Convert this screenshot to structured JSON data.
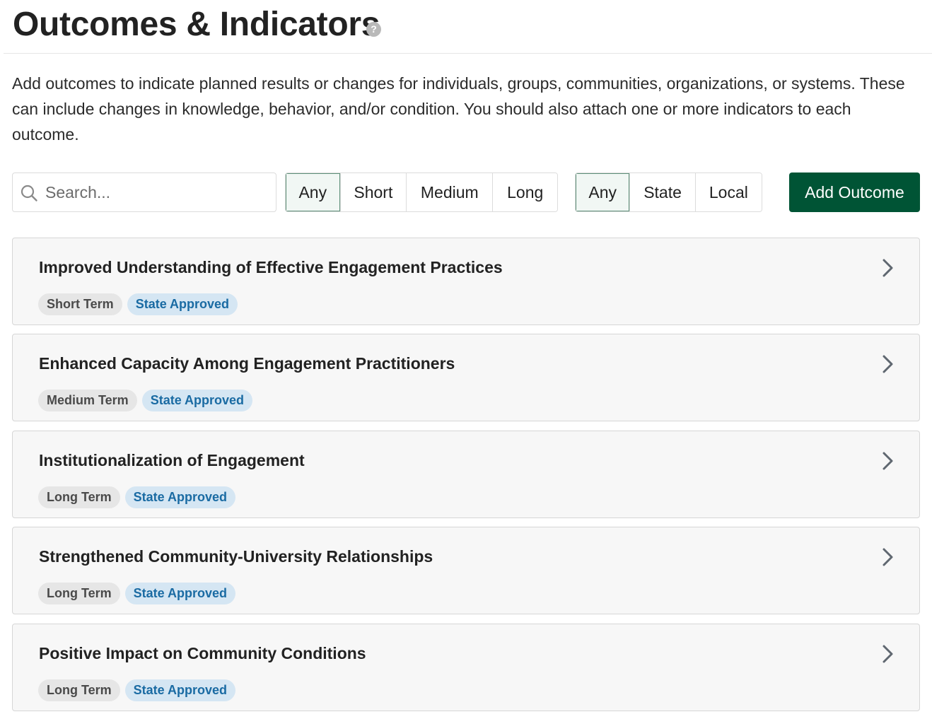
{
  "header": {
    "title": "Outcomes & Indicators",
    "help_glyph": "?"
  },
  "description": "Add outcomes to indicate planned results or changes for individuals, groups, communities, organizations, or systems. These can include changes in knowledge, behavior, and/or condition. You should also attach one or more indicators to each outcome.",
  "search": {
    "placeholder": "Search...",
    "value": ""
  },
  "term_filter": {
    "options": [
      "Any",
      "Short",
      "Medium",
      "Long"
    ],
    "selected": "Any"
  },
  "source_filter": {
    "options": [
      "Any",
      "State",
      "Local"
    ],
    "selected": "Any"
  },
  "add_button_label": "Add Outcome",
  "outcomes": [
    {
      "title": "Improved Understanding of Effective Engagement Practices",
      "term": "Short Term",
      "status": "State Approved"
    },
    {
      "title": "Enhanced Capacity Among Engagement Practitioners",
      "term": "Medium Term",
      "status": "State Approved"
    },
    {
      "title": "Institutionalization of Engagement",
      "term": "Long Term",
      "status": "State Approved"
    },
    {
      "title": "Strengthened Community-University Relationships",
      "term": "Long Term",
      "status": "State Approved"
    },
    {
      "title": "Positive Impact on Community Conditions",
      "term": "Long Term",
      "status": "State Approved"
    }
  ],
  "icons": {
    "help": "question-circle-icon",
    "search": "search-icon",
    "card": "chevron-right-icon"
  },
  "colors": {
    "primary": "#005435",
    "active_filter_bg": "#f1f7f4",
    "term_badge_bg": "#e6e6e6",
    "status_badge_bg": "#d5e6f3",
    "status_badge_text": "#1a6ba3"
  }
}
